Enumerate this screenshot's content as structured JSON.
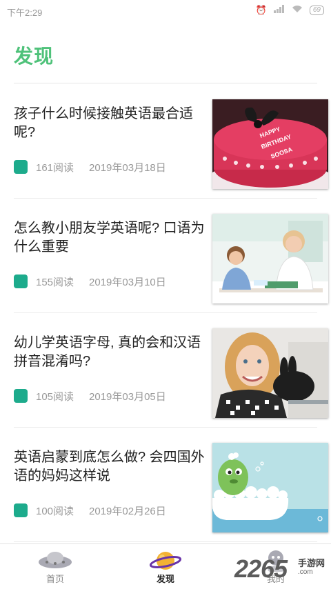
{
  "status_bar": {
    "time": "下午2:29",
    "battery": "69",
    "icons": [
      "alarm-icon",
      "signal-icon",
      "wifi-icon",
      "battery-icon"
    ]
  },
  "page": {
    "title": "发现"
  },
  "articles": [
    {
      "title": "孩子什么时候接触英语最合适呢?",
      "reads": "161阅读",
      "date": "2019年03月18日",
      "image": "birthday-cake"
    },
    {
      "title": "怎么教小朋友学英语呢? 口语为什么重要",
      "reads": "155阅读",
      "date": "2019年03月10日",
      "image": "teacher-and-boy"
    },
    {
      "title": "幼儿学英语字母, 真的会和汉语拼音混淆吗?",
      "reads": "105阅读",
      "date": "2019年03月05日",
      "image": "girl-with-rabbit"
    },
    {
      "title": "英语启蒙到底怎么做? 会四国外语的妈妈这样说",
      "reads": "100阅读",
      "date": "2019年02月26日",
      "image": "cartoon-bathtub"
    }
  ],
  "tabbar": {
    "items": [
      {
        "label": "首页",
        "icon": "ufo-icon",
        "active": false
      },
      {
        "label": "发现",
        "icon": "planet-icon",
        "active": true
      },
      {
        "label": "我的",
        "icon": "profile-icon",
        "active": false
      }
    ]
  },
  "watermark": {
    "number": "2265",
    "line1": "手游网",
    "line2": ".com"
  },
  "colors": {
    "accent": "#4fc27a",
    "tag": "#1dab8c",
    "active_tab": "#222222"
  }
}
